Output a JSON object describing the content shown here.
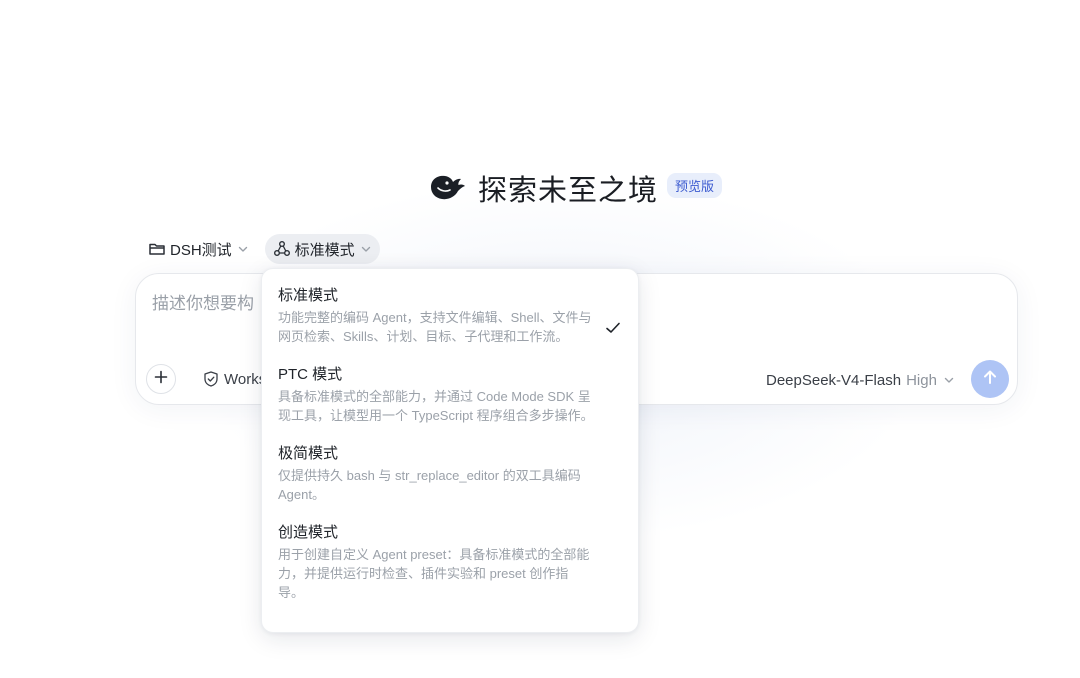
{
  "hero": {
    "title": "探索未至之境",
    "badge": "预览版"
  },
  "chips": {
    "workspace": "DSH测试",
    "mode": "标准模式"
  },
  "composer": {
    "placeholder": "描述你想要构",
    "workspace_label": "Workspace",
    "model_name": "DeepSeek-V4-Flash",
    "model_level": "High"
  },
  "menu": {
    "items": [
      {
        "title": "标准模式",
        "desc": "功能完整的编码 Agent，支持文件编辑、Shell、文件与网页检索、Skills、计划、目标、子代理和工作流。",
        "selected": true
      },
      {
        "title": "PTC 模式",
        "desc": "具备标准模式的全部能力，并通过 Code Mode SDK 呈现工具，让模型用一个 TypeScript 程序组合多步操作。",
        "selected": false
      },
      {
        "title": "极简模式",
        "desc": "仅提供持久 bash 与 str_replace_editor 的双工具编码 Agent。",
        "selected": false
      },
      {
        "title": "创造模式",
        "desc": "用于创建自定义 Agent preset：具备标准模式的全部能力，并提供运行时检查、插件实验和 preset 创作指导。",
        "selected": false
      }
    ]
  },
  "colors": {
    "accent": "#aec4f5",
    "badge_text": "#3c5bd0",
    "badge_bg": "#e8eefb"
  },
  "icons": {
    "logo": "whale-logo-icon",
    "workspace": "folder-icon",
    "mode": "mode-nodes-icon",
    "chevron": "chevron-down-icon",
    "add": "plus-icon",
    "shield": "shield-icon",
    "send": "arrow-up-icon",
    "check": "check-icon"
  }
}
